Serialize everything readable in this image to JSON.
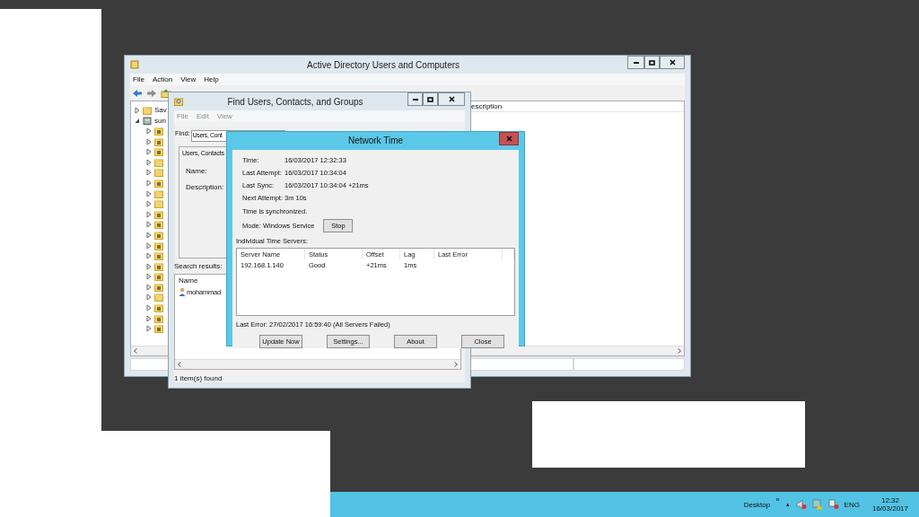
{
  "ad_window": {
    "title": "Active Directory Users and Computers",
    "menu": [
      "File",
      "Action",
      "View",
      "Help"
    ],
    "tree": [
      {
        "label": "Sav",
        "kind": "folder",
        "expanded": false
      },
      {
        "label": "sun",
        "kind": "domain",
        "expanded": true,
        "children": [
          {
            "kind": "ou",
            "expanded": false
          },
          {
            "kind": "ou",
            "expanded": false
          },
          {
            "kind": "ou",
            "expanded": false
          },
          {
            "kind": "folder",
            "expanded": false
          },
          {
            "kind": "folder",
            "expanded": false
          },
          {
            "kind": "ou",
            "expanded": false
          },
          {
            "kind": "folder",
            "expanded": false
          },
          {
            "kind": "folder",
            "expanded": false
          },
          {
            "kind": "ou",
            "expanded": false
          },
          {
            "kind": "ou",
            "expanded": false
          },
          {
            "kind": "ou",
            "expanded": false
          },
          {
            "kind": "ou",
            "expanded": false
          },
          {
            "kind": "ou",
            "expanded": false
          },
          {
            "kind": "ou",
            "expanded": false
          },
          {
            "kind": "ou",
            "expanded": false
          },
          {
            "kind": "ou",
            "expanded": false
          },
          {
            "kind": "folder",
            "expanded": false
          },
          {
            "kind": "ou",
            "expanded": false
          },
          {
            "kind": "ou",
            "expanded": false
          },
          {
            "kind": "ou",
            "expanded": false
          }
        ]
      }
    ],
    "list_columns": [
      "escription"
    ]
  },
  "find_window": {
    "title": "Find Users, Contacts, and Groups",
    "menu": [
      {
        "label": "File",
        "disabled": true
      },
      {
        "label": "Edit",
        "disabled": true
      },
      {
        "label": "View",
        "disabled": true
      }
    ],
    "find_label": "Find:",
    "find_value": "Users, Cont",
    "tab": "Users, Contacts",
    "field_labels": [
      "Name:",
      "Description:"
    ],
    "results_label": "Search results:",
    "results_columns": [
      "Name"
    ],
    "results": [
      "mohammad"
    ],
    "status": "1 item(s) found"
  },
  "network_time": {
    "title": "Network Time",
    "info": [
      {
        "label": "Time:",
        "value": "16/03/2017 12:32:33"
      },
      {
        "label": "Last Attempt:",
        "value": "16/03/2017 10:34:04"
      },
      {
        "label": "Last Sync:",
        "value": "16/03/2017 10:34:04 +21ms"
      },
      {
        "label": "Next Attempt:",
        "value": "3m 10s"
      }
    ],
    "sync_status": "Time is synchronized.",
    "mode": "Mode: Windows Service",
    "mode_button": "Stop",
    "servers_label": "Individual Time Servers:",
    "columns": [
      "Server Name",
      "Status",
      "Offset",
      "Lag",
      "Last Error"
    ],
    "servers": [
      [
        "192.168.1.140",
        "Good",
        "+21ms",
        "1ms"
      ]
    ],
    "last_error": "Last Error:  27/02/2017 16:59:40 (All Servers Failed)",
    "buttons": [
      "Update Now",
      "Settings...",
      "About",
      "Close"
    ]
  },
  "taskbar": {
    "toolbar": "Desktop",
    "chevron": "»",
    "tray_toggle": "▲",
    "language": "ENG",
    "time": "12:32",
    "date": "16/03/2017"
  }
}
